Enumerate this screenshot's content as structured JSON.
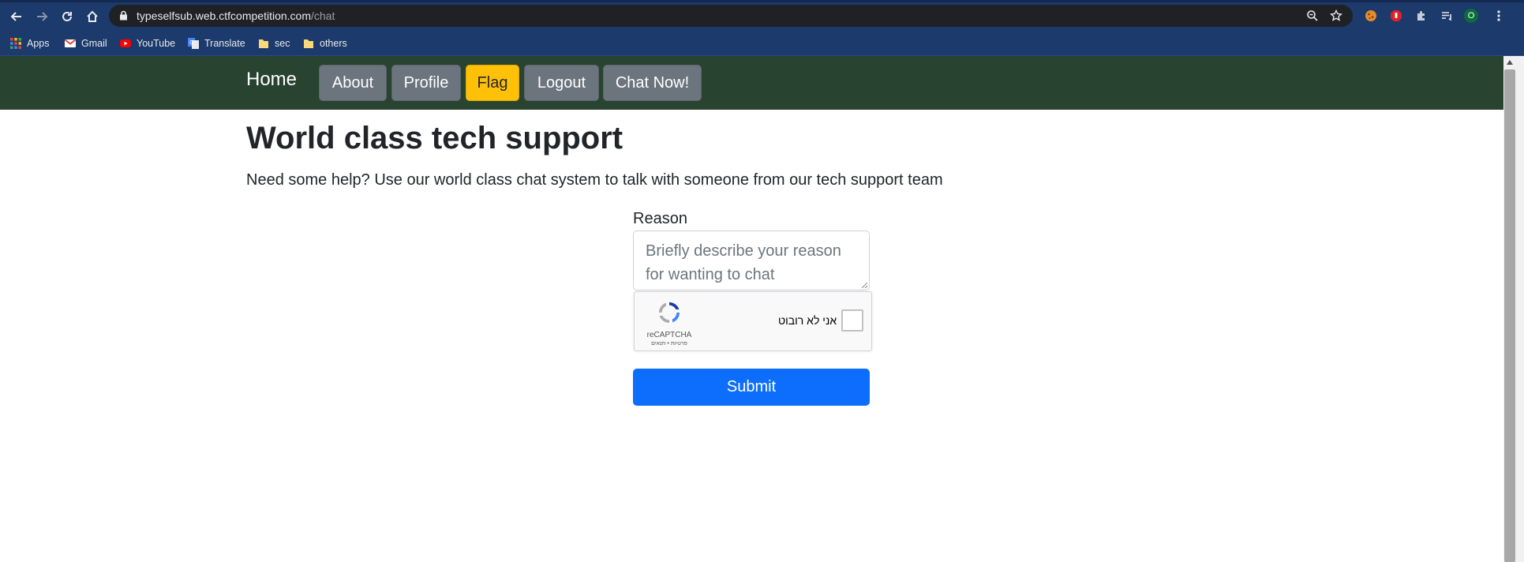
{
  "browser": {
    "url_domain": "typeselfsub.web.ctfcompetition.com",
    "url_path": "/chat",
    "profile_initial": "O",
    "bookmarks": [
      "Apps",
      "Gmail",
      "YouTube",
      "Translate",
      "sec",
      "others"
    ]
  },
  "nav": {
    "brand": "Home",
    "items": [
      "About",
      "Profile",
      "Flag",
      "Logout",
      "Chat Now!"
    ]
  },
  "main": {
    "title": "World class tech support",
    "lead": "Need some help? Use our world class chat system to talk with someone from our tech support team",
    "reason_label": "Reason",
    "reason_placeholder": "Briefly describe your reason for wanting to chat",
    "submit_label": "Submit"
  },
  "captcha": {
    "checkbox_text": "אני לא רובוט",
    "brand": "reCAPTCHA",
    "links": "פרטיות • תנאים"
  },
  "colors": {
    "navbar": "#28432f",
    "nav_button": "#6c757d",
    "flag_button": "#ffc107",
    "submit": "#0d6efd"
  }
}
